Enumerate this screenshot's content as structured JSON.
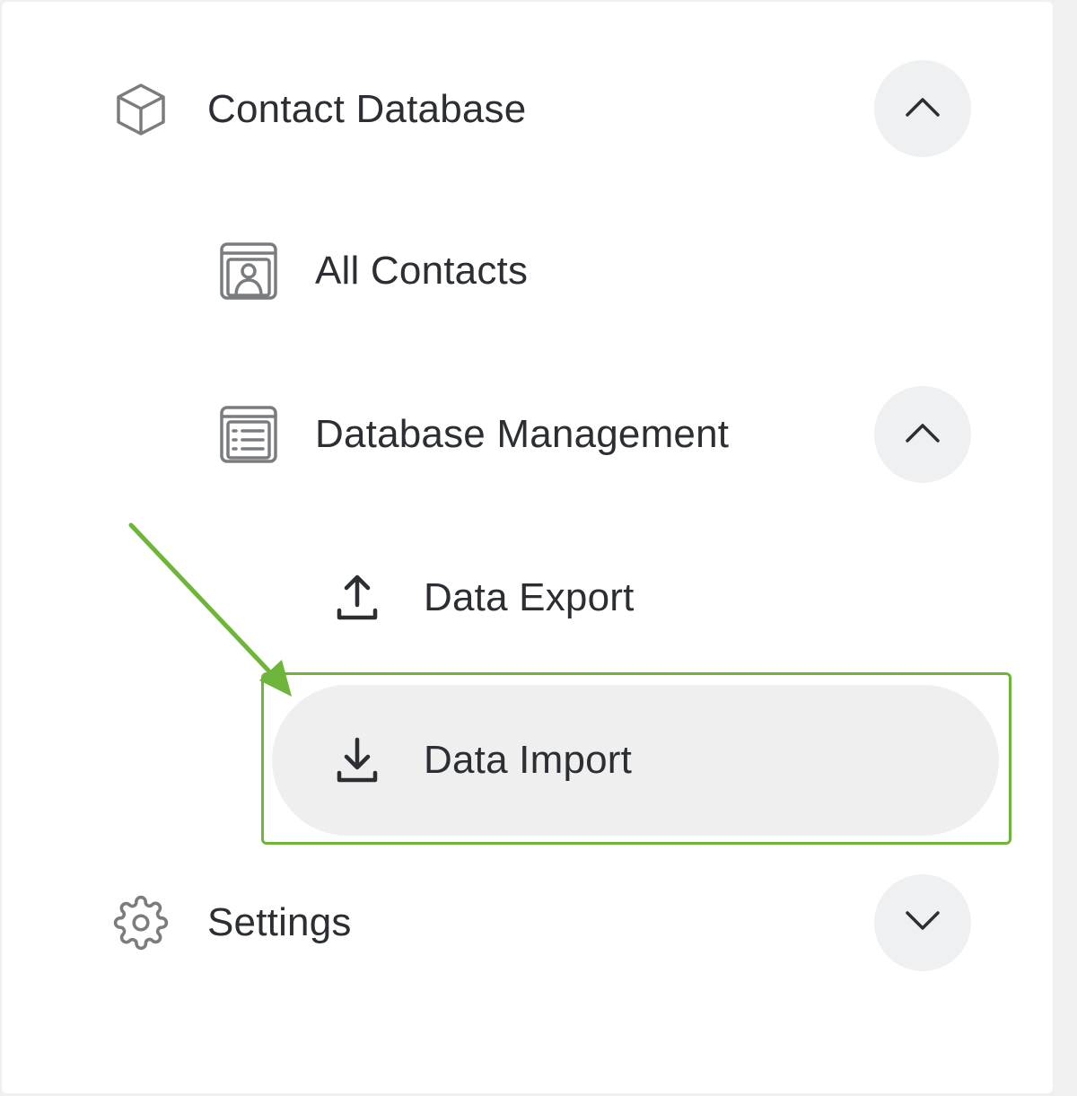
{
  "nav": {
    "contact_database": {
      "label": "Contact Database",
      "icon": "cube-icon",
      "expanded": true
    },
    "all_contacts": {
      "label": "All Contacts",
      "icon": "contact-card-icon"
    },
    "database_management": {
      "label": "Database Management",
      "icon": "list-document-icon",
      "expanded": true
    },
    "data_export": {
      "label": "Data Export",
      "icon": "upload-icon"
    },
    "data_import": {
      "label": "Data Import",
      "icon": "download-icon",
      "selected": true
    },
    "settings": {
      "label": "Settings",
      "icon": "gear-icon",
      "expanded": false
    }
  },
  "colors": {
    "text": "#2b2e33",
    "icon_gray": "#7a7d80",
    "chevron_bg": "#eef0f1",
    "selected_bg": "#efefef",
    "highlight_green": "#6db63a"
  }
}
